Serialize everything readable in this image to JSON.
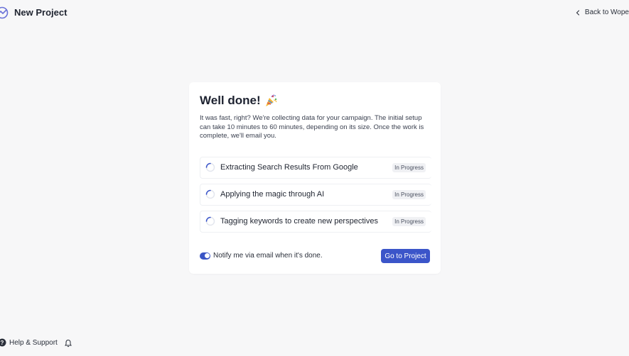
{
  "header": {
    "title": "New Project",
    "back_label": "Back to Wope"
  },
  "card": {
    "title": "Well done!",
    "description": "It was fast, right? We're collecting data for your campaign. The initial setup can take 10 minutes to 60 minutes, depending on its size. Once the work is complete, we'll email you.",
    "tasks": [
      {
        "label": "Extracting Search Results From Google",
        "status": "In Progress"
      },
      {
        "label": "Applying the magic through AI",
        "status": "In Progress"
      },
      {
        "label": "Tagging keywords to create new perspectives",
        "status": "In Progress"
      }
    ],
    "notify_label": "Notify me via email when it's done.",
    "notify_enabled": true,
    "go_button": "Go to Project"
  },
  "footer": {
    "help_label": "Help & Support"
  },
  "colors": {
    "accent": "#3b55c9",
    "background": "#f7f7f8"
  },
  "icons": [
    "logo-icon",
    "chevron-left-icon",
    "party-popper-icon",
    "spinner-icon",
    "help-icon",
    "bell-icon"
  ]
}
